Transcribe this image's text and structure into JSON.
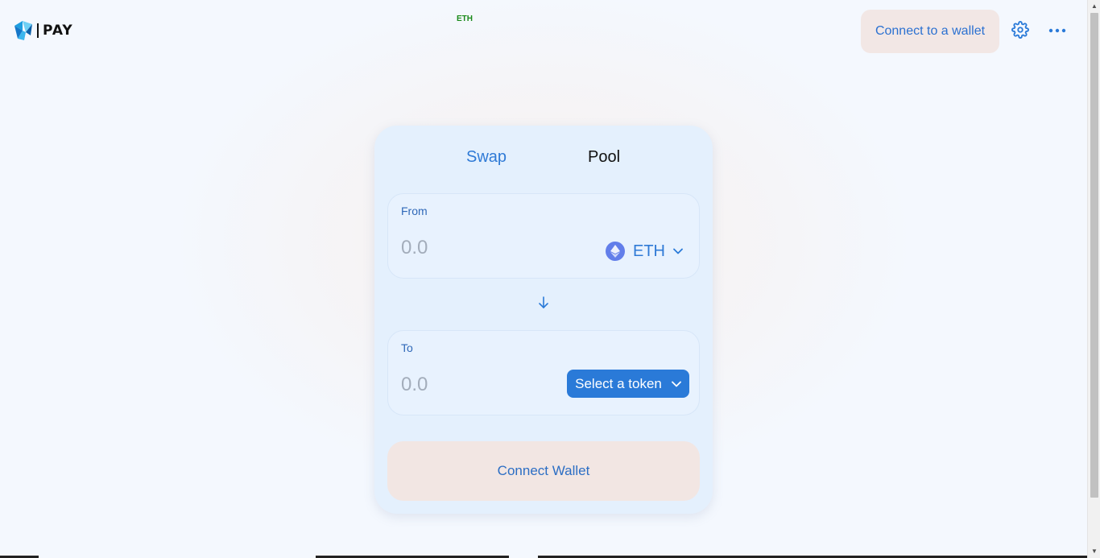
{
  "header": {
    "logo_text": "PAY",
    "network_label": "ETH",
    "connect_button_label": "Connect to a wallet"
  },
  "tabs": [
    {
      "label": "Swap",
      "active": true
    },
    {
      "label": "Pool",
      "active": false
    }
  ],
  "swap": {
    "from": {
      "label": "From",
      "amount_placeholder": "0.0",
      "token_symbol": "ETH",
      "token_icon": "ethereum-icon"
    },
    "to": {
      "label": "To",
      "amount_placeholder": "0.0",
      "select_label": "Select a token"
    },
    "connect_wallet_label": "Connect Wallet"
  },
  "colors": {
    "accent": "#2a7ad8",
    "page_bg": "#f4f8fe",
    "card_bg": "#e4f0fd",
    "connect_bg": "#f2e6e3",
    "network_green": "#1a8a1a",
    "eth_purple": "#627eea"
  },
  "icons": [
    "logo-icon",
    "gear-icon",
    "more-dots-icon",
    "ethereum-icon",
    "chevron-down-icon",
    "arrow-down-icon"
  ]
}
